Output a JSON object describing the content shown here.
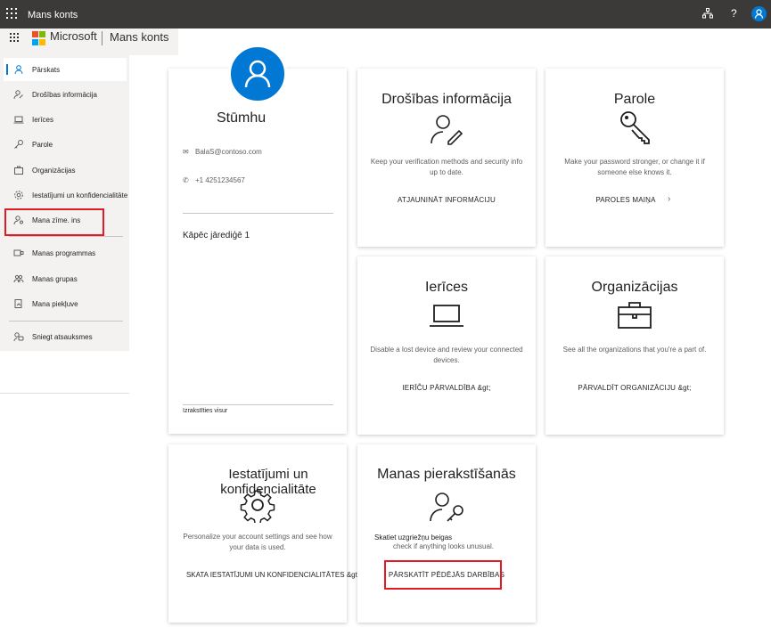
{
  "topbar": {
    "title": "Mans konts",
    "icons": [
      "app-launcher-icon",
      "org-chart-icon",
      "help-icon",
      "avatar"
    ],
    "help": "?"
  },
  "subheader": {
    "brand": "Microsoft",
    "app_title": "Mans konts"
  },
  "sidebar": {
    "items": [
      {
        "label": "Pārskats",
        "icon": "person-icon"
      },
      {
        "label": "Drošības informācija",
        "icon": "person-key-icon"
      },
      {
        "label": "Ierīces",
        "icon": "laptop-icon"
      },
      {
        "label": "Parole",
        "icon": "key-icon"
      },
      {
        "label": "Organizācijas",
        "icon": "briefcase-icon"
      },
      {
        "label": "Iestatījumi un konfidencialitāte",
        "icon": "gear-icon"
      },
      {
        "label": "Mana zīme. ins",
        "icon": "signin-icon"
      },
      {
        "label": "Manas programmas",
        "icon": "apps-icon"
      },
      {
        "label": "Manas grupas",
        "icon": "groups-icon"
      },
      {
        "label": "Mana piekļuve",
        "icon": "access-icon"
      },
      {
        "label": "Sniegt atsauksmes",
        "icon": "feedback-icon"
      }
    ]
  },
  "profile": {
    "name": "Stūmhu",
    "email": "BalaS@contoso.com",
    "phone": "+1 4251234567",
    "why": "Kāpēc jārediģē 1",
    "signout": "Izrakstīties visur"
  },
  "cards": {
    "security": {
      "title": "Drošības informācija",
      "desc": "Keep your verification methods and security info up to date.",
      "link": "ATJAUNINĀT INFORMĀCIJU"
    },
    "password": {
      "title": "Parole",
      "desc": "Make your password stronger, or change it if someone else knows it.",
      "link": "PAROLES MAIŅA",
      "arrow": "›"
    },
    "devices": {
      "title": "Ierīces",
      "desc": "Disable a lost device and review your connected devices.",
      "link": "IERĪČU PĀRVALDĪBA &gt;"
    },
    "orgs": {
      "title": "Organizācijas",
      "desc": "See all the organizations that you're a part of.",
      "link": "PĀRVALDĪT ORGANIZĀCIJU &gt;"
    },
    "settings": {
      "title": "Iestatījumi un konfidencialitāte",
      "desc": "Personalize your account settings and see how your data is used.",
      "link": "SKATA IESTATĪJUMI UN KONFIDENCIALITĀTES &gt;"
    },
    "signins": {
      "title": "Manas pierakstīšanās",
      "desc1": "Skatiet uzgriežņu beigas",
      "desc2": "check if anything looks unusual.",
      "link": "PĀRSKATĪT PĒDĒJĀS DARBĪBAS"
    }
  },
  "colors": {
    "accent": "#0078d4",
    "topbar": "#3b3a39",
    "highlight_box": "#e01b24"
  }
}
